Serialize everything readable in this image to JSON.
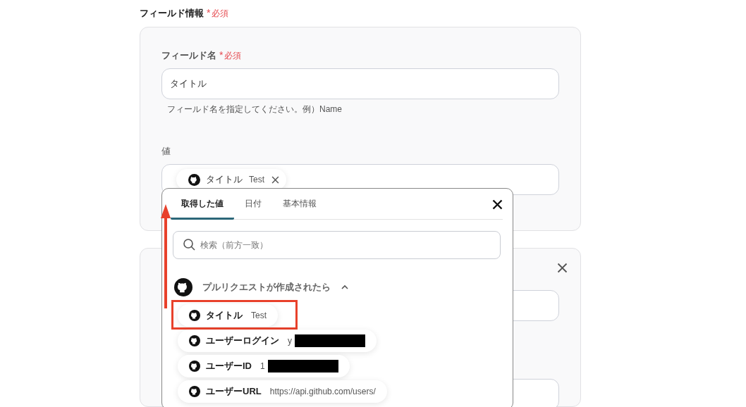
{
  "section": {
    "title": "フィールド情報",
    "mark": "*",
    "required": "必須"
  },
  "field_name": {
    "label": "フィールド名",
    "mark": "*",
    "required": "必須",
    "value": "タイトル",
    "hint": "フィールド名を指定してください。例）Name"
  },
  "value_field": {
    "label": "値",
    "chips": [
      {
        "label": "タイトル",
        "value": "Test"
      }
    ]
  },
  "picker": {
    "tabs": [
      {
        "label": "取得した値",
        "selected": true
      },
      {
        "label": "日付",
        "selected": false
      },
      {
        "label": "基本情報",
        "selected": false
      }
    ],
    "search": {
      "placeholder": "検索（前方一致）"
    },
    "group": {
      "title": "プルリクエストが作成されたら",
      "expanded": true
    },
    "items": [
      {
        "label": "タイトル",
        "value": "Test",
        "highlighted": true,
        "redacted": false
      },
      {
        "label": "ユーザーログイン",
        "value": "y",
        "highlighted": false,
        "redacted": true
      },
      {
        "label": "ユーザーID",
        "value": "1",
        "highlighted": false,
        "redacted": true
      },
      {
        "label": "ユーザーURL",
        "value": "https://api.github.com/users/",
        "highlighted": false,
        "redacted": false
      }
    ]
  }
}
